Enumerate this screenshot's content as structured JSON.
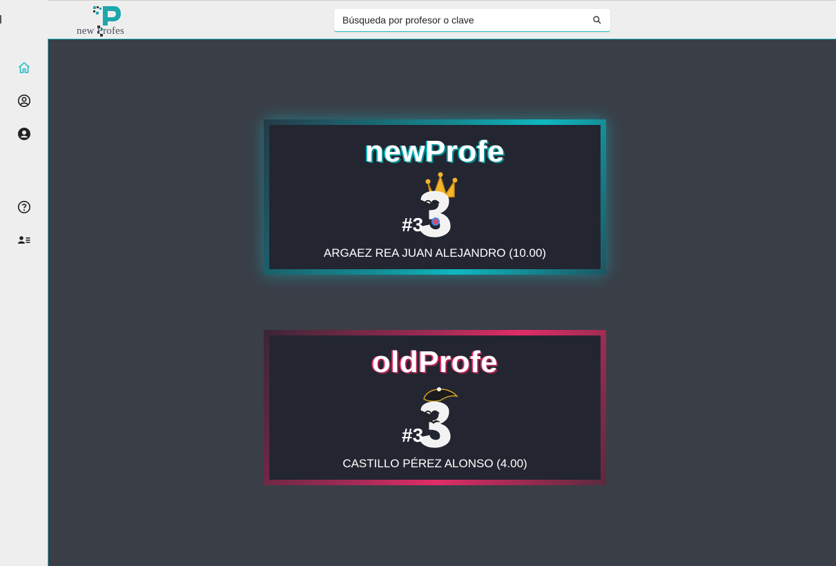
{
  "header": {
    "logo_text": "new Profes",
    "search": {
      "placeholder": "Búsqueda por profesor o clave"
    }
  },
  "sidebar": {
    "items": [
      {
        "icon": "home-icon",
        "active": true
      },
      {
        "icon": "user-circle-icon",
        "active": false
      },
      {
        "icon": "user-filled-icon",
        "active": false
      },
      {
        "icon": "help-icon",
        "active": false
      },
      {
        "icon": "contact-list-icon",
        "active": false
      }
    ]
  },
  "cards": {
    "new": {
      "title": "newProfe",
      "rank": "#3",
      "name": "ARGAEZ REA JUAN ALEJANDRO (10.00)"
    },
    "old": {
      "title": "oldProfe",
      "rank": "#3",
      "name": "CASTILLO PÉREZ ALONSO (4.00)"
    }
  },
  "colors": {
    "accent_teal": "#2ec2c7",
    "accent_pink": "#e02d68",
    "background": "#3a3e47",
    "card": "#232631"
  }
}
